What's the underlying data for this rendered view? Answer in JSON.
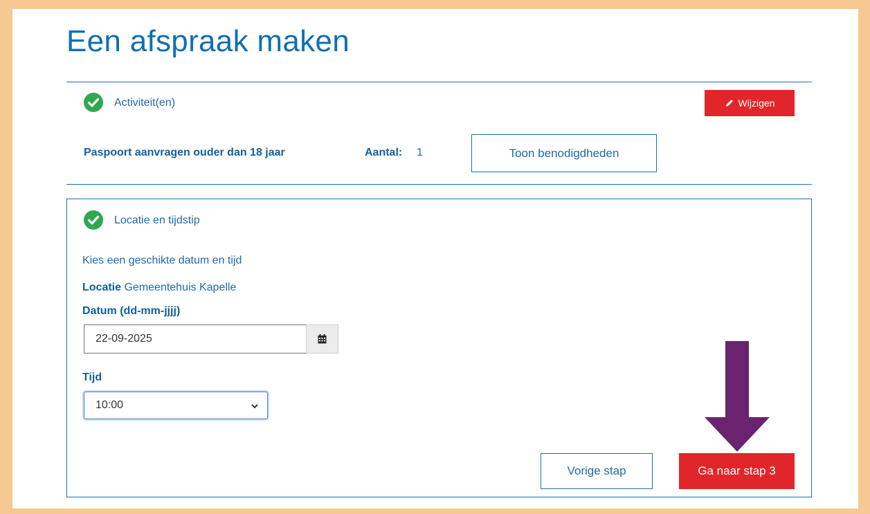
{
  "header": {
    "title": "Een afspraak maken"
  },
  "activities": {
    "title": "Activiteit(en)",
    "edit_label": "Wijzigen",
    "item_name": "Paspoort aanvragen ouder dan 18 jaar",
    "count_label": "Aantal:",
    "count_value": "1",
    "requirements_button": "Toon benodigdheden"
  },
  "location_time": {
    "title": "Locatie en tijdstip",
    "instruction": "Kies een geschikte datum en tijd",
    "location_label": "Locatie",
    "location_value": "Gemeentehuis Kapelle",
    "date_label": "Datum (dd-mm-jjjj)",
    "date_value": "22-09-2025",
    "time_label": "Tijd",
    "time_value": "10:00",
    "prev_button": "Vorige stap",
    "next_button": "Ga naar stap 3"
  },
  "colors": {
    "primary_blue": "#1f6aa6",
    "title_blue": "#0f6fb4",
    "accent_red": "#e0262a",
    "check_green": "#2fa84f",
    "annotation_arrow": "#6b2370",
    "frame_background": "#f6c892"
  },
  "icons": [
    "check-circle-icon",
    "pencil-icon",
    "calendar-icon",
    "chevron-down-icon",
    "down-arrow-annotation"
  ]
}
